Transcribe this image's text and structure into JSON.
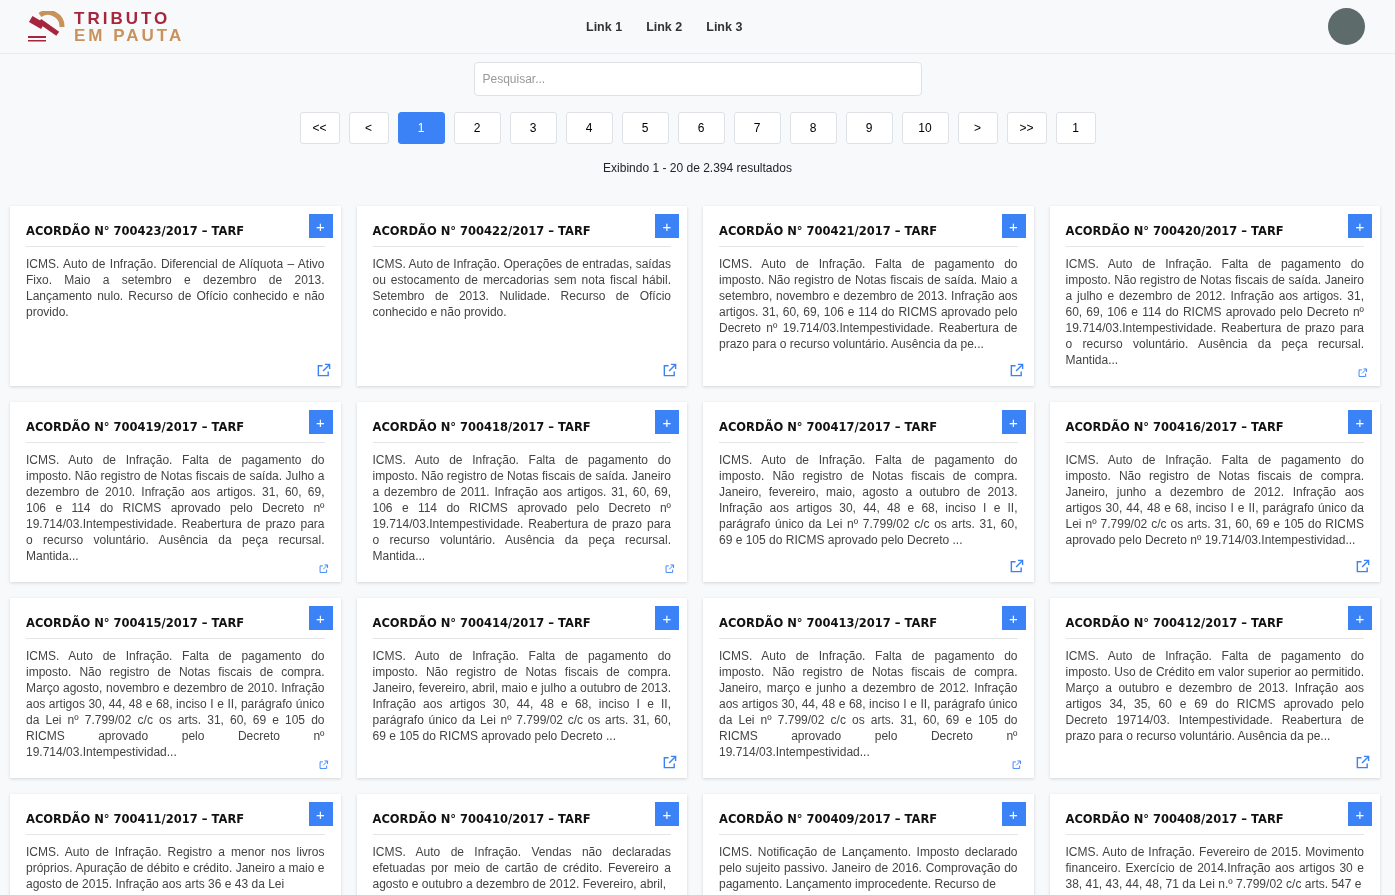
{
  "header": {
    "logo": {
      "line1": "TRIBUTO",
      "line2": "EM PAUTA"
    },
    "nav": [
      {
        "label": "Link 1"
      },
      {
        "label": "Link 2"
      },
      {
        "label": "Link 3"
      }
    ]
  },
  "search": {
    "placeholder": "Pesquisar..."
  },
  "pagination": [
    {
      "label": "<<",
      "selected": false
    },
    {
      "label": "<",
      "selected": false
    },
    {
      "label": "1",
      "selected": true
    },
    {
      "label": "2",
      "selected": false
    },
    {
      "label": "3",
      "selected": false
    },
    {
      "label": "4",
      "selected": false
    },
    {
      "label": "5",
      "selected": false
    },
    {
      "label": "6",
      "selected": false
    },
    {
      "label": "7",
      "selected": false
    },
    {
      "label": "8",
      "selected": false
    },
    {
      "label": "9",
      "selected": false
    },
    {
      "label": "10",
      "selected": false
    },
    {
      "label": ">",
      "selected": false
    },
    {
      "label": ">>",
      "selected": false
    },
    {
      "label": "1",
      "selected": false
    }
  ],
  "results_text": "Exibindo 1 - 20 de 2.394 resultados",
  "cards": [
    {
      "title": "ACORDÃO N° 700423/2017 – TARF",
      "add": "+",
      "summary": "ICMS. Auto de Infração. Diferencial de Alíquota – Ativo Fixo. Maio a setembro e dezembro de 2013. Lançamento nulo. Recurso de Ofício conhecido e não provido."
    },
    {
      "title": "ACORDÃO N° 700422/2017 – TARF",
      "add": "+",
      "summary": "ICMS. Auto de Infração. Operações de entradas, saídas ou estocamento de mercadorias sem nota fiscal hábil. Setembro de 2013. Nulidade. Recurso de Ofício conhecido e não provido."
    },
    {
      "title": "ACORDÃO N° 700421/2017 – TARF",
      "add": "+",
      "summary": "ICMS. Auto de Infração. Falta de pagamento do imposto. Não registro de Notas fiscais de saída. Maio a setembro, novembro e dezembro de 2013. Infração aos artigos. 31, 60, 69, 106 e 114 do RICMS aprovado pelo Decreto nº 19.714/03.Intempestividade. Reabertura de prazo para o recurso voluntário. Ausência da pe..."
    },
    {
      "title": "ACORDÃO N° 700420/2017 – TARF",
      "add": "+",
      "summary": "ICMS. Auto de Infração. Falta de pagamento do imposto. Não registro de Notas fiscais de saída. Janeiro a julho e dezembro de 2012. Infração aos artigos. 31, 60, 69, 106 e 114 do RICMS aprovado pelo Decreto nº 19.714/03.Intempestividade. Reabertura de prazo para o recurso voluntário. Ausência da peça recursal. Mantida..."
    },
    {
      "title": "ACORDÃO N° 700419/2017 – TARF",
      "add": "+",
      "summary": "ICMS. Auto de Infração. Falta de pagamento do imposto. Não registro de Notas fiscais de saída. Julho a dezembro de 2010. Infração aos artigos. 31, 60, 69, 106 e 114 do RICMS aprovado pelo Decreto nº 19.714/03.Intempestividade. Reabertura de prazo para o recurso voluntário. Ausência da peça recursal. Mantida..."
    },
    {
      "title": "ACORDÃO N° 700418/2017 – TARF",
      "add": "+",
      "summary": "ICMS. Auto de Infração. Falta de pagamento do imposto. Não registro de Notas fiscais de saída. Janeiro a dezembro de 2011. Infração aos artigos. 31, 60, 69, 106 e 114 do RICMS aprovado pelo Decreto nº 19.714/03.Intempestividade. Reabertura de prazo para o recurso voluntário. Ausência da peça recursal. Mantida..."
    },
    {
      "title": "ACORDÃO N° 700417/2017 – TARF",
      "add": "+",
      "summary": "ICMS. Auto de Infração. Falta de pagamento do imposto. Não registro de Notas fiscais de compra. Janeiro, fevereiro, maio, agosto a outubro de 2013. Infração aos artigos 30, 44, 48 e 68, inciso I e II, parágrafo único da Lei nº 7.799/02 c/c os arts. 31, 60, 69 e 105 do RICMS aprovado pelo Decreto ..."
    },
    {
      "title": "ACORDÃO N° 700416/2017 – TARF",
      "add": "+",
      "summary": "ICMS. Auto de Infração. Falta de pagamento do imposto. Não registro de Notas fiscais de compra. Janeiro, junho a dezembro de 2012. Infração aos artigos 30, 44, 48 e 68, inciso I e II, parágrafo único da Lei nº 7.799/02 c/c os arts. 31, 60, 69 e 105 do RICMS aprovado pelo Decreto nº 19.714/03.Intempestividad..."
    },
    {
      "title": "ACORDÃO N° 700415/2017 – TARF",
      "add": "+",
      "summary": "ICMS. Auto de Infração. Falta de pagamento do imposto. Não registro de Notas fiscais de compra. Março agosto, novembro e dezembro de 2010. Infração aos artigos 30, 44, 48 e 68, inciso I e II, parágrafo único da Lei nº 7.799/02 c/c os arts. 31, 60, 69 e 105 do RICMS aprovado pelo Decreto nº 19.714/03.Intempestividad..."
    },
    {
      "title": "ACORDÃO N° 700414/2017 – TARF",
      "add": "+",
      "summary": "ICMS. Auto de Infração. Falta de pagamento do imposto. Não registro de Notas fiscais de compra. Janeiro, fevereiro, abril, maio e julho a outubro de 2013. Infração aos artigos 30, 44, 48 e 68, inciso I e II, parágrafo único da Lei nº 7.799/02 c/c os arts. 31, 60, 69 e 105 do RICMS aprovado pelo Decreto ..."
    },
    {
      "title": "ACORDÃO N° 700413/2017 – TARF",
      "add": "+",
      "summary": "ICMS. Auto de Infração. Falta de pagamento do imposto. Não registro de Notas fiscais de compra. Janeiro, março e junho a dezembro de 2012. Infração aos artigos 30, 44, 48 e 68, inciso I e II, parágrafo único da Lei nº 7.799/02 c/c os arts. 31, 60, 69 e 105 do RICMS aprovado pelo Decreto nº 19.714/03.Intempestividad..."
    },
    {
      "title": "ACORDÃO N° 700412/2017 – TARF",
      "add": "+",
      "summary": "ICMS. Auto de Infração. Falta de pagamento do imposto. Uso de Crédito em valor superior ao permitido. Março a outubro e dezembro de 2013. Infração aos artigos 34, 35, 60 e 69 do RICMS aprovado pelo Decreto 19714/03. Intempestividade. Reabertura de prazo para o recurso voluntário. Ausência da pe..."
    },
    {
      "title": "ACORDÃO N° 700411/2017 – TARF",
      "add": "+",
      "summary": "ICMS. Auto de Infração. Registro a menor nos livros próprios. Apuração de débito e crédito. Janeiro a maio e agosto de 2015. Infração aos arts 36 e 43 da Lei"
    },
    {
      "title": "ACORDÃO N° 700410/2017 – TARF",
      "add": "+",
      "summary": "ICMS. Auto de Infração. Vendas não declaradas efetuadas por meio de cartão de crédito. Fevereiro a agosto e outubro a dezembro de 2012. Fevereiro, abril,"
    },
    {
      "title": "ACORDÃO N° 700409/2017 – TARF",
      "add": "+",
      "summary": "ICMS. Notificação de Lançamento. Imposto declarado pelo sujeito passivo. Janeiro de 2016. Comprovação do pagamento. Lançamento improcedente. Recurso de"
    },
    {
      "title": "ACORDÃO N° 700408/2017 – TARF",
      "add": "+",
      "summary": "ICMS. Auto de Infração. Fevereiro de 2015. Movimento financeiro. Exercício de 2014.Infração aos artigos 30 e 38, 41, 43, 44, 48, 71 da Lei n.º 7.799/02 c/c arts. 547 e"
    }
  ]
}
